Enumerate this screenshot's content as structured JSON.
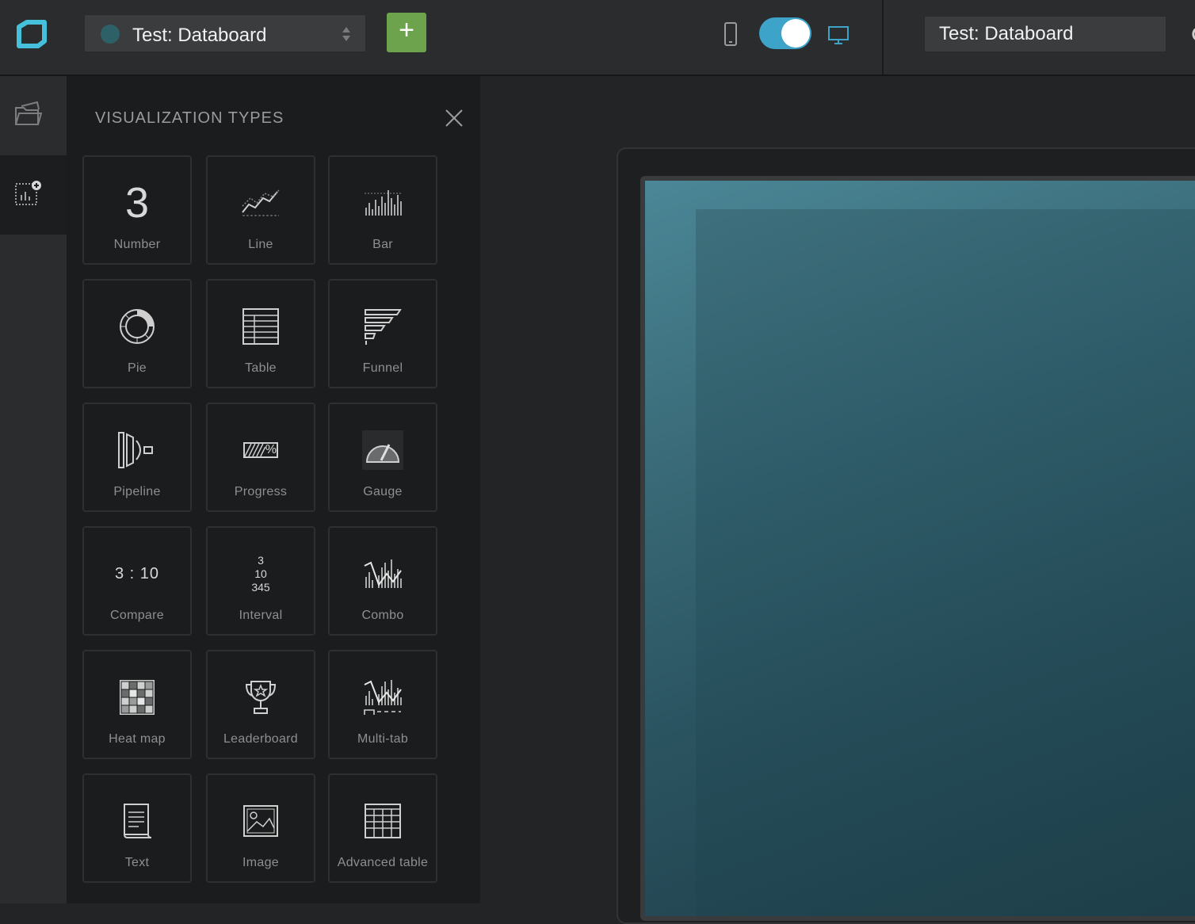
{
  "header": {
    "dashboard_selector": {
      "name": "Test: Databoard",
      "dot_color": "#2e6068"
    },
    "add_button_label": "+",
    "view_mode": {
      "mobile_icon": "phone-icon",
      "desktop_icon": "desktop-icon",
      "toggle_on": true,
      "accent": "#3ea3c8"
    },
    "title_field_value": "Test: Databoard"
  },
  "rail": {
    "items": [
      {
        "icon": "folder-icon",
        "active": false
      },
      {
        "icon": "add-datablock-icon",
        "active": true
      }
    ]
  },
  "panel": {
    "title": "VISUALIZATION TYPES",
    "close_icon": "close-icon",
    "tiles": [
      {
        "label": "Number",
        "icon": "number-icon"
      },
      {
        "label": "Line",
        "icon": "line-chart-icon"
      },
      {
        "label": "Bar",
        "icon": "bar-chart-icon"
      },
      {
        "label": "Pie",
        "icon": "pie-chart-icon"
      },
      {
        "label": "Table",
        "icon": "table-icon"
      },
      {
        "label": "Funnel",
        "icon": "funnel-icon"
      },
      {
        "label": "Pipeline",
        "icon": "pipeline-icon"
      },
      {
        "label": "Progress",
        "icon": "progress-icon"
      },
      {
        "label": "Gauge",
        "icon": "gauge-icon"
      },
      {
        "label": "Compare",
        "icon": "compare-icon"
      },
      {
        "label": "Interval",
        "icon": "interval-icon"
      },
      {
        "label": "Combo",
        "icon": "combo-chart-icon"
      },
      {
        "label": "Heat map",
        "icon": "heat-map-icon"
      },
      {
        "label": "Leaderboard",
        "icon": "trophy-icon"
      },
      {
        "label": "Multi-tab",
        "icon": "multi-tab-icon"
      },
      {
        "label": "Text",
        "icon": "text-document-icon"
      },
      {
        "label": "Image",
        "icon": "image-icon"
      },
      {
        "label": "Advanced table",
        "icon": "advanced-table-icon"
      }
    ],
    "icon_text": {
      "number": "3",
      "progress": "%",
      "compare": "3 : 10",
      "interval_lines": [
        "3",
        "10",
        "345"
      ]
    }
  },
  "colors": {
    "topbar": "#2b2c2d",
    "panel": "#1b1c1d",
    "add_button": "#6ea34d",
    "logo": "#45c1db"
  }
}
